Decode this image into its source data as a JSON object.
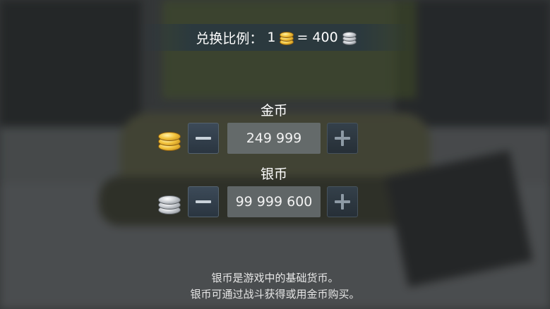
{
  "exchange_rate": {
    "label": "兑换比例：",
    "gold_amount": "1",
    "equals": "= 400",
    "gold_icon": "gold-coin-icon",
    "silver_icon": "silver-coin-icon"
  },
  "gold": {
    "label": "金币",
    "value": "249 999",
    "icon": "gold-coin-stack-icon"
  },
  "silver": {
    "label": "银币",
    "value": "99 999 600",
    "icon": "silver-coin-stack-icon"
  },
  "info": {
    "line1": "银币是游戏中的基础货币。",
    "line2": "银币可通过战斗获得或用金币购买。"
  },
  "colors": {
    "gold": "#f2c23a",
    "silver": "#c9cdd2",
    "button": "#34414d"
  }
}
